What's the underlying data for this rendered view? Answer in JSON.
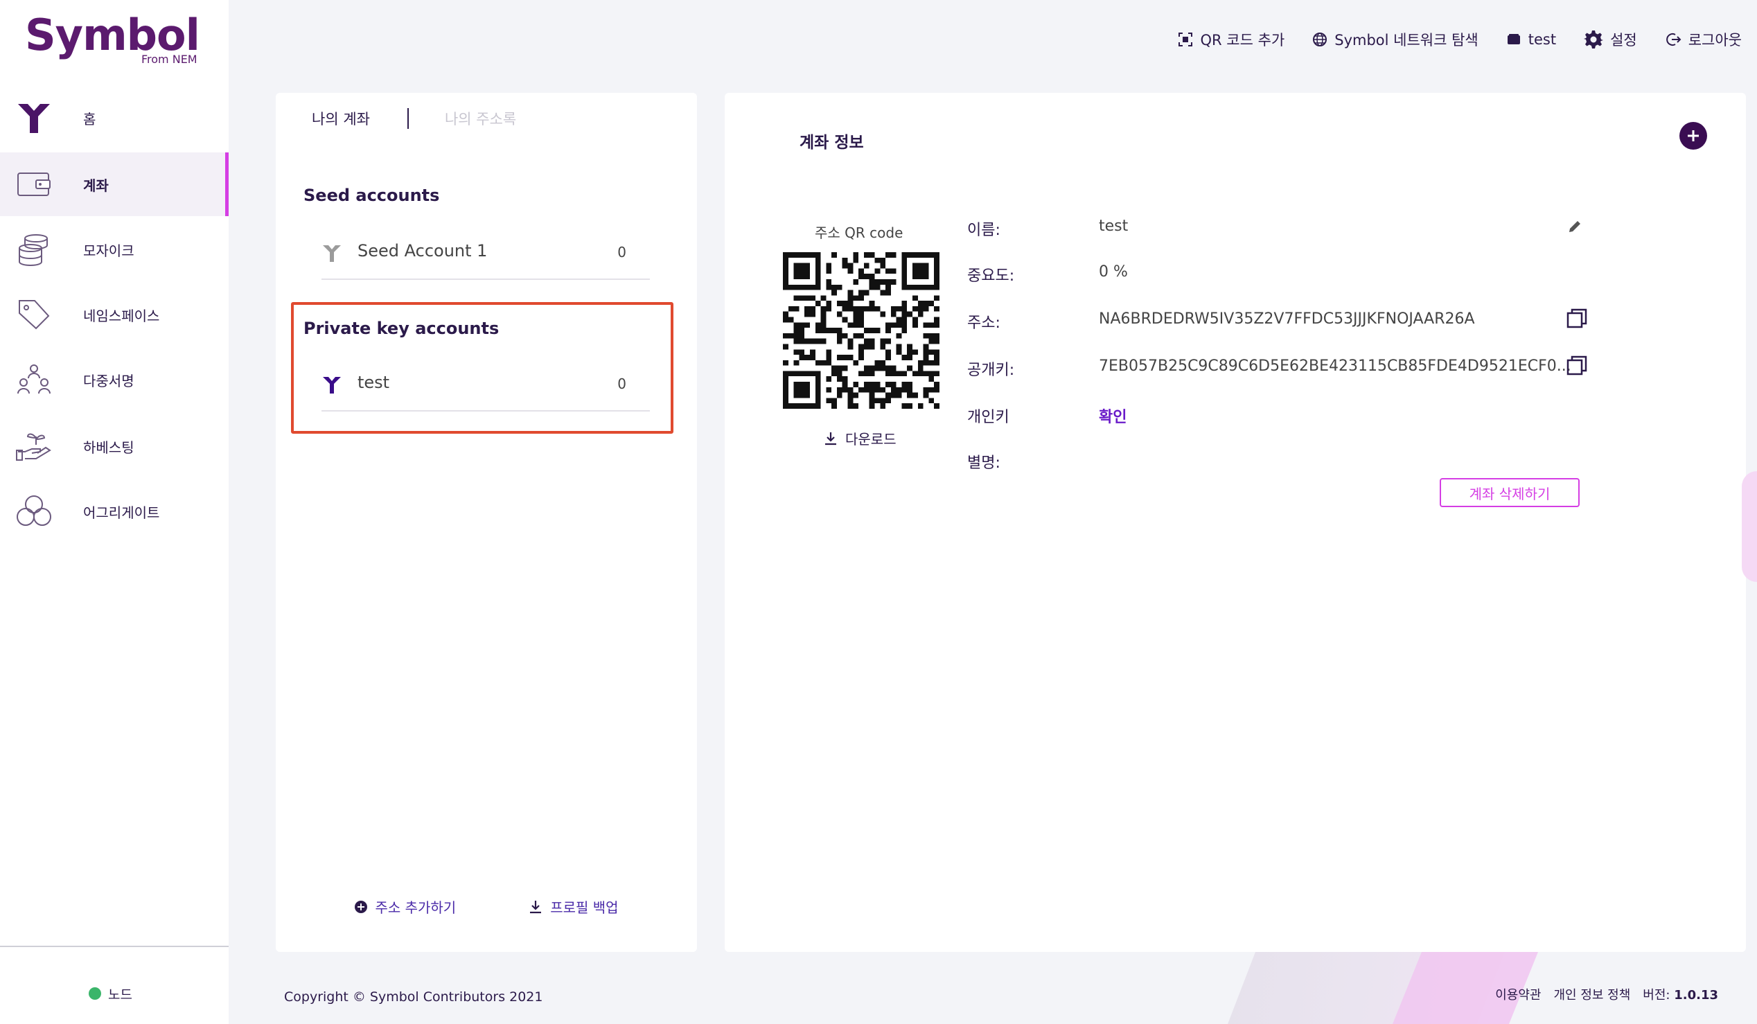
{
  "brand": {
    "logo_text": "Symbol",
    "logo_sub": "From NEM",
    "color": "#5b1a6e"
  },
  "sidebar": {
    "items": [
      {
        "label": "홈",
        "icon": "symbol-logo-icon"
      },
      {
        "label": "계좌",
        "icon": "wallet-icon",
        "active": true
      },
      {
        "label": "모자이크",
        "icon": "coins-stack-icon"
      },
      {
        "label": "네임스페이스",
        "icon": "tag-icon"
      },
      {
        "label": "다중서명",
        "icon": "multisig-people-icon"
      },
      {
        "label": "하베스팅",
        "icon": "harvest-hand-icon"
      },
      {
        "label": "어그리게이트",
        "icon": "aggregate-circles-icon"
      }
    ],
    "node_label": "노드",
    "node_status_color": "#3bb56a"
  },
  "header": {
    "add_qr": "QR 코드 추가",
    "explorer": "Symbol 네트워크 탐색",
    "wallet": "test",
    "settings": "설정",
    "logout": "로그아웃"
  },
  "accounts_panel": {
    "tab_my_accounts": "나의 계좌",
    "tab_address_book": "나의 주소록",
    "seed_title": "Seed accounts",
    "seed_accounts": [
      {
        "name": "Seed Account 1",
        "balance": "0"
      }
    ],
    "pk_title": "Private key accounts",
    "pk_accounts": [
      {
        "name": "test",
        "balance": "0"
      }
    ],
    "add_address": "주소 추가하기",
    "backup_profile": "프로필 백업"
  },
  "account_info": {
    "title": "계좌 정보",
    "qr_label": "주소 QR code",
    "download": "다운로드",
    "name_label": "이름:",
    "name_value": "test",
    "importance_label": "중요도:",
    "importance_value": "0 %",
    "address_label": "주소:",
    "address_value": "NA6BRDEDRW5IV35Z2V7FFDC53JJJKFNOJAAR26A",
    "pubkey_label": "공개키:",
    "pubkey_value": "7EB057B25C9C89C6D5E62BE423115CB85FDE4D9521ECF0...",
    "privkey_label": "개인키",
    "privkey_value": "확인",
    "alias_label": "별명:",
    "delete_button": "계좌 삭제하기"
  },
  "footer": {
    "copyright": "Copyright © Symbol Contributors 2021",
    "terms": "이용약관",
    "privacy": "개인 정보 정책",
    "version_label": "버전:",
    "version_value": "1.0.13"
  },
  "colors": {
    "accent": "#d53ee4",
    "primary_dark": "#3a0d52",
    "link": "#4a2aa8",
    "highlight": "#e04a2f"
  }
}
